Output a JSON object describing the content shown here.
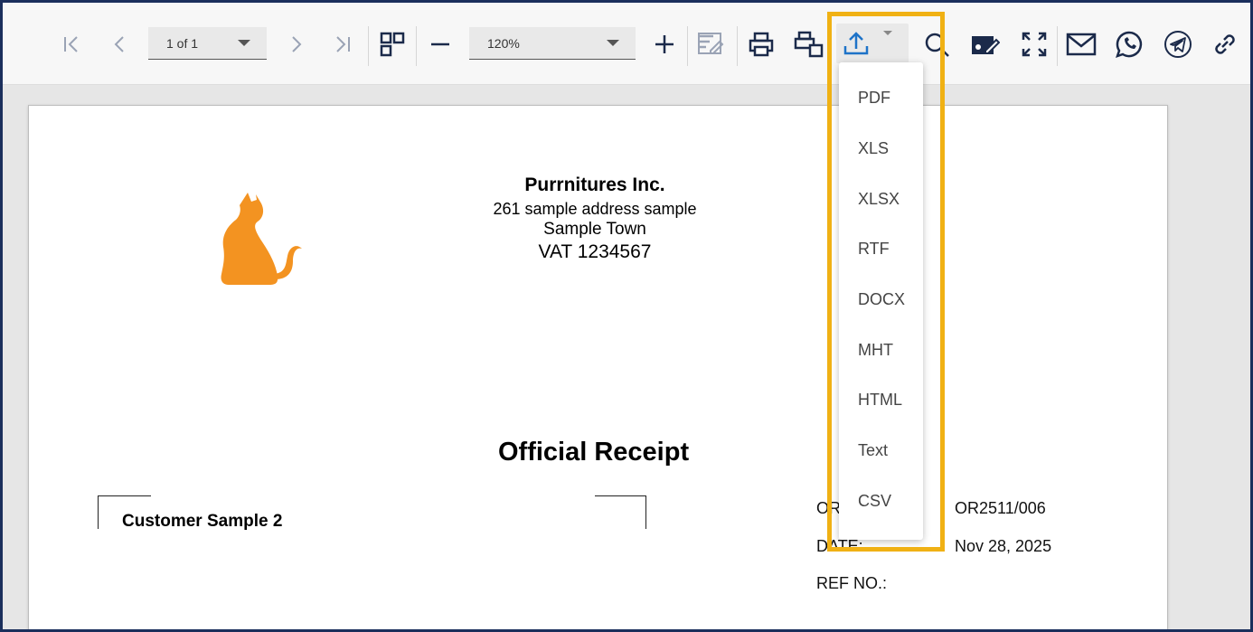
{
  "toolbar": {
    "page_indicator": "1 of 1",
    "zoom_value": "120%",
    "icons": [
      "first-page-icon",
      "prev-page-icon",
      "next-page-icon",
      "last-page-icon",
      "multipage-icon",
      "zoom-out-icon",
      "zoom-in-icon",
      "edit-icon",
      "print-icon",
      "print-page-icon",
      "export-icon",
      "search-icon",
      "design-icon",
      "fullscreen-icon",
      "email-icon",
      "whatsapp-icon",
      "telegram-icon",
      "link-icon"
    ]
  },
  "export_menu": {
    "items": [
      "PDF",
      "XLS",
      "XLSX",
      "RTF",
      "DOCX",
      "MHT",
      "HTML",
      "Text",
      "CSV"
    ]
  },
  "document": {
    "company_name": "Purrnitures Inc.",
    "address_line1": "261 sample address sample",
    "address_line2": "Sample Town",
    "vat": "VAT 1234567",
    "receipt_title": "Official Receipt",
    "customer_name": "Customer Sample 2",
    "or_label": "OR",
    "or_value": "OR2511/006",
    "date_label": "DATE:",
    "date_value": "Nov 28, 2025",
    "ref_label": "REF NO.:"
  },
  "colors": {
    "highlight": "#f0b114",
    "frame": "#1b2f5c",
    "logo": "#f39321",
    "export_icon": "#1e73c8",
    "toolbar_icon": "#1b2a4a"
  }
}
